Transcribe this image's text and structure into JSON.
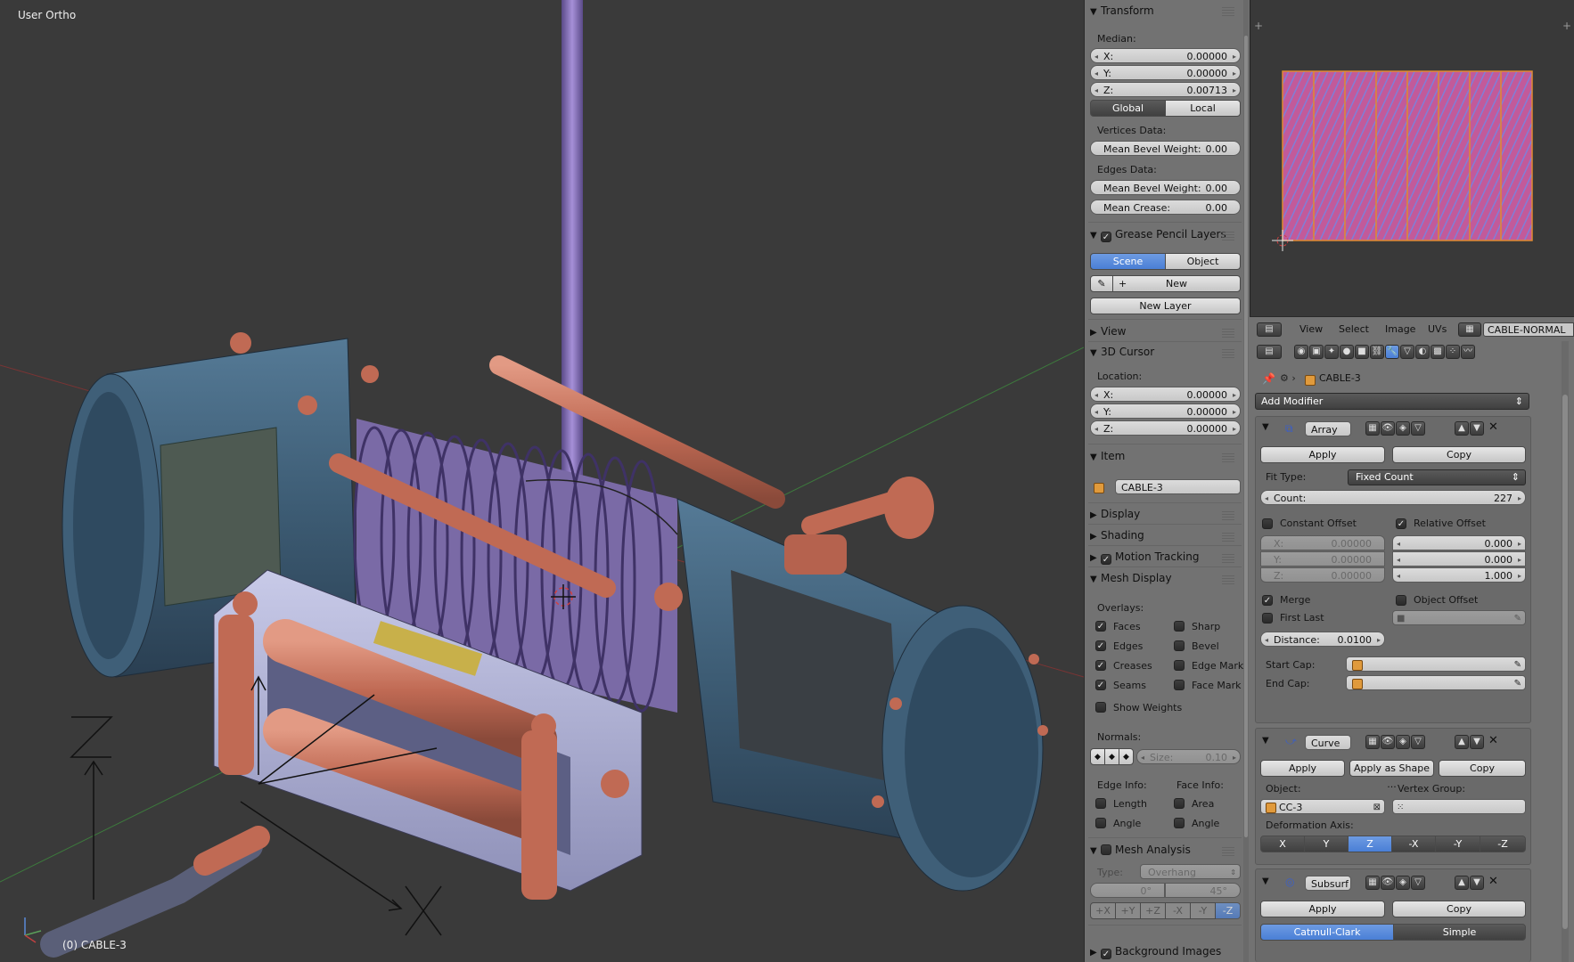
{
  "viewport": {
    "view_label": "User Ortho",
    "object_label": "(0) CABLE-3"
  },
  "npanel": {
    "transform": {
      "title": "Transform",
      "median_label": "Median:",
      "x_label": "X:",
      "x_value": "0.00000",
      "y_label": "Y:",
      "y_value": "0.00000",
      "z_label": "Z:",
      "z_value": "0.00713",
      "global_label": "Global",
      "local_label": "Local",
      "vertices_data_label": "Vertices Data:",
      "mean_bevel_weight_label": "Mean Bevel Weight:",
      "mean_bevel_weight_v": "0.00",
      "edges_data_label": "Edges Data:",
      "mean_bevel_weight_e": "0.00",
      "mean_crease_label": "Mean Crease:",
      "mean_crease_value": "0.00"
    },
    "grease": {
      "title": "Grease Pencil Layers",
      "scene_label": "Scene",
      "object_label": "Object",
      "new_label": "New",
      "new_layer_label": "New Layer"
    },
    "view": {
      "title": "View"
    },
    "cursor": {
      "title": "3D Cursor",
      "location_label": "Location:",
      "x_label": "X:",
      "x_value": "0.00000",
      "y_label": "Y:",
      "y_value": "0.00000",
      "z_label": "Z:",
      "z_value": "0.00000"
    },
    "item": {
      "title": "Item",
      "name": "CABLE-3"
    },
    "display": {
      "title": "Display"
    },
    "shading": {
      "title": "Shading"
    },
    "motion": {
      "title": "Motion Tracking"
    },
    "mesh_display": {
      "title": "Mesh Display",
      "overlays_label": "Overlays:",
      "faces": "Faces",
      "sharp": "Sharp",
      "edges": "Edges",
      "bevel": "Bevel",
      "creases": "Creases",
      "edge_mark": "Edge Mark",
      "seams": "Seams",
      "face_mark": "Face Mark",
      "show_weights": "Show Weights",
      "normals_label": "Normals:",
      "size_label": "Size:",
      "size_value": "0.10",
      "edge_info_label": "Edge Info:",
      "face_info_label": "Face Info:",
      "length": "Length",
      "area": "Area",
      "angle_e": "Angle",
      "angle_f": "Angle"
    },
    "mesh_analysis": {
      "title": "Mesh Analysis",
      "type_label": "Type:",
      "type_value": "Overhang",
      "min_value": "0°",
      "max_value": "45°",
      "axes": [
        "+X",
        "+Y",
        "+Z",
        "-X",
        "-Y",
        "-Z"
      ]
    },
    "background": {
      "title": "Background Images"
    }
  },
  "image_editor": {
    "menu": [
      "View",
      "Select",
      "Image",
      "UVs"
    ],
    "image_name": "CABLE-NORMAL"
  },
  "properties": {
    "object_name": "CABLE-3",
    "add_modifier_label": "Add Modifier",
    "array": {
      "name": "Array",
      "apply_label": "Apply",
      "copy_label": "Copy",
      "fit_type_label": "Fit Type:",
      "fit_type_value": "Fixed Count",
      "count_label": "Count:",
      "count_value": "227",
      "constant_offset_label": "Constant Offset",
      "relative_offset_label": "Relative Offset",
      "const_x_label": "X:",
      "const_x": "0.00000",
      "const_y_label": "Y:",
      "const_y": "0.00000",
      "const_z_label": "Z:",
      "const_z": "0.00000",
      "rel_x": "0.000",
      "rel_y": "0.000",
      "rel_z": "1.000",
      "merge_label": "Merge",
      "object_offset_label": "Object Offset",
      "first_last_label": "First Last",
      "distance_label": "Distance:",
      "distance_value": "0.0100",
      "start_cap_label": "Start Cap:",
      "end_cap_label": "End Cap:"
    },
    "curve": {
      "name": "Curve",
      "apply_label": "Apply",
      "apply_shape_label": "Apply as Shape ...",
      "copy_label": "Copy",
      "object_label": "Object:",
      "vertex_group_label": "Vertex Group:",
      "object_value": "CC-3",
      "deformation_axis_label": "Deformation Axis:",
      "axes": [
        "X",
        "Y",
        "Z",
        "-X",
        "-Y",
        "-Z"
      ]
    },
    "subsurf": {
      "name": "Subsurf",
      "apply_label": "Apply",
      "copy_label": "Copy",
      "catmull_label": "Catmull-Clark",
      "simple_label": "Simple"
    }
  },
  "colors": {
    "accent_blue": "#5680d8",
    "panel_bg": "#727272",
    "viewport_bg": "#3a3a3a",
    "winch_blue": "#3b5a73",
    "copper": "#c06a54",
    "cable_purple": "#8a70b8",
    "uv_pink": "#c25a9a"
  }
}
